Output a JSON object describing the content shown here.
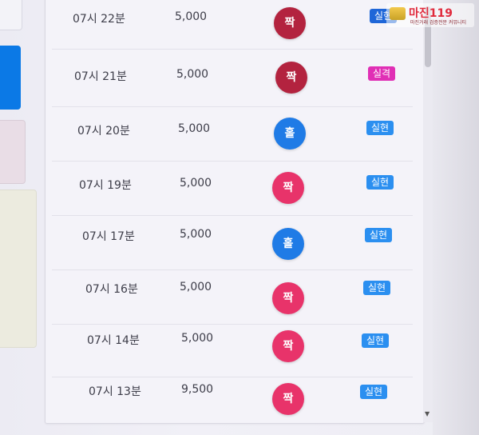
{
  "watermark": {
    "title": "마진119",
    "subtitle": "마진거래 검증전문 커뮤니티"
  },
  "rows": [
    {
      "time": "07시 22분",
      "amount": "5,000",
      "result": "짝",
      "status": "실현"
    },
    {
      "time": "07시 21분",
      "amount": "5,000",
      "result": "짝",
      "status": "실격"
    },
    {
      "time": "07시 20분",
      "amount": "5,000",
      "result": "홀",
      "status": "실현"
    },
    {
      "time": "07시 19분",
      "amount": "5,000",
      "result": "짝",
      "status": "실현"
    },
    {
      "time": "07시 17분",
      "amount": "5,000",
      "result": "홀",
      "status": "실현"
    },
    {
      "time": "07시 16분",
      "amount": "5,000",
      "result": "짝",
      "status": "실현"
    },
    {
      "time": "07시 14분",
      "amount": "5,000",
      "result": "짝",
      "status": "실현"
    },
    {
      "time": "07시 13분",
      "amount": "9,500",
      "result": "짝",
      "status": "실현"
    }
  ],
  "colors": {
    "odd": "#1f7be6",
    "even": "#e8336a",
    "badge_real": "#2b8ff0",
    "badge_fail": "#e02fb5"
  }
}
